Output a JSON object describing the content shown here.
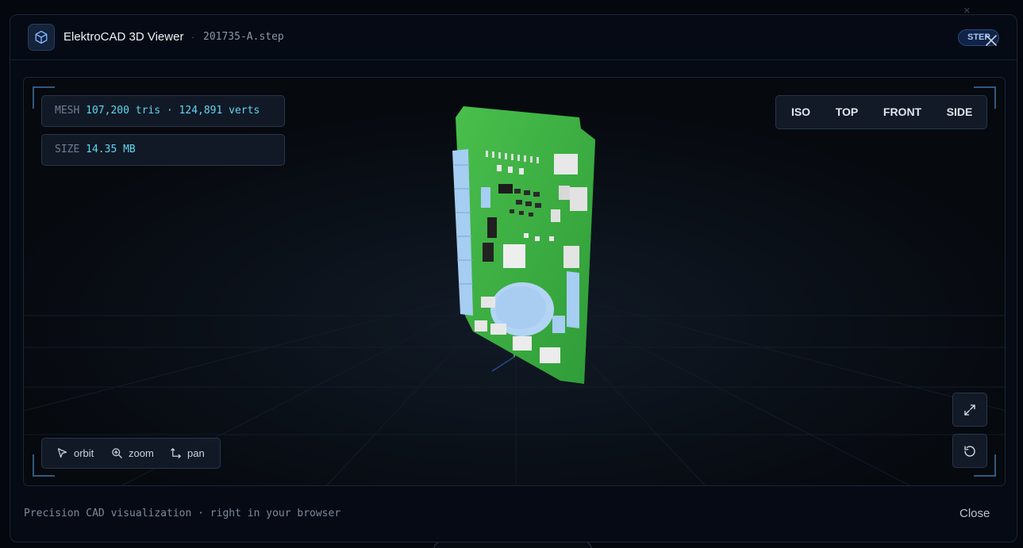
{
  "backdrop": {
    "close_glyph": "×"
  },
  "modal": {
    "title": "ElektroCAD 3D Viewer",
    "separator": "·",
    "filename": "201735-A.step",
    "badge": "STEP",
    "icons": {
      "app": "cube-icon",
      "close": "close-icon"
    }
  },
  "stats": {
    "mesh_label": "MESH",
    "mesh_value": "107,200 tris · 124,891 verts",
    "size_label": "SIZE",
    "size_value": "14.35 MB"
  },
  "views": {
    "iso": "ISO",
    "top": "TOP",
    "front": "FRONT",
    "side": "SIDE"
  },
  "controls": {
    "fullscreen_icon": "expand-icon",
    "reset_icon": "reset-view-icon"
  },
  "hints": {
    "orbit": "orbit",
    "zoom": "zoom",
    "pan": "pan",
    "icons": {
      "orbit": "cursor-icon",
      "zoom": "zoom-in-icon",
      "pan": "pan-axes-icon"
    }
  },
  "footer": {
    "tagline": "Precision CAD visualization · right in your browser",
    "close_label": "Close"
  },
  "colors": {
    "background": "#050a14",
    "accent": "#5fd6f0",
    "pcb_green": "#3cb044",
    "connector_blue": "#a6cdf2",
    "badge_bg": "#0f2347"
  }
}
